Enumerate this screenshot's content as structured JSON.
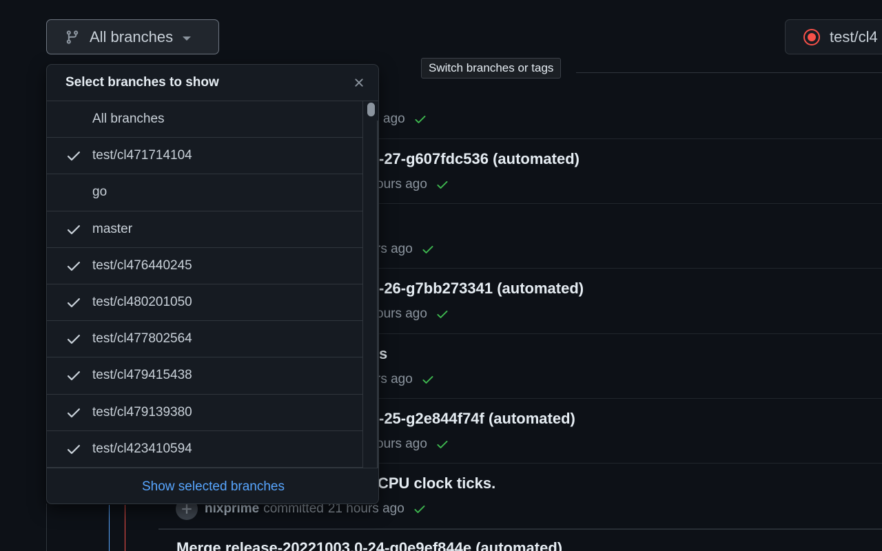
{
  "branch_button": {
    "label": "All branches"
  },
  "right_button": {
    "label": "test/cl4"
  },
  "tooltip": {
    "text": "Switch branches or tags"
  },
  "dropdown": {
    "title": "Select branches to show",
    "items": [
      {
        "name": "All branches",
        "checked": false
      },
      {
        "name": "test/cl471714104",
        "checked": true
      },
      {
        "name": "go",
        "checked": false
      },
      {
        "name": "master",
        "checked": true
      },
      {
        "name": "test/cl476440245",
        "checked": true
      },
      {
        "name": "test/cl480201050",
        "checked": true
      },
      {
        "name": "test/cl477802564",
        "checked": true
      },
      {
        "name": "test/cl479415438",
        "checked": true
      },
      {
        "name": "test/cl479139380",
        "checked": true
      },
      {
        "name": "test/cl423410594",
        "checked": true
      }
    ],
    "footer_link": "Show selected branches"
  },
  "commits": [
    {
      "title": "",
      "meta_time": "ago"
    },
    {
      "title": "-27-g607fdc536 (automated)",
      "meta_time": "ours ago"
    },
    {
      "title": "",
      "meta_time": "rs ago"
    },
    {
      "title": "-26-g7bb273341 (automated)",
      "meta_time": "ours ago"
    },
    {
      "title": "s",
      "meta_time": "rs ago"
    },
    {
      "title": "-25-g2e844f74f (automated)",
      "meta_time": "ours ago"
    },
    {
      "title": "CPU clock ticks.",
      "author": "nixprime",
      "committed": "committed",
      "meta_time": "21 hours ago"
    },
    {
      "title": "Merge release-20221003.0-24-g0e9ef844e (automated)"
    }
  ],
  "colors": {
    "accent": "#58a6ff",
    "success": "#3fb950",
    "danger": "#f85149"
  }
}
